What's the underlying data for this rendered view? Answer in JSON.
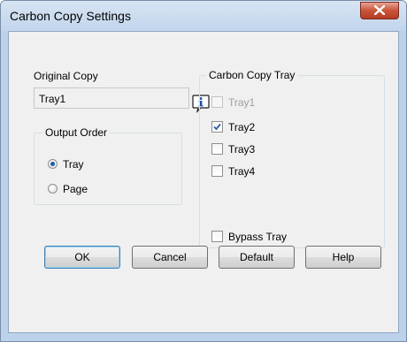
{
  "window": {
    "title": "Carbon Copy Settings",
    "close_icon": "close-x-icon"
  },
  "original_copy": {
    "label": "Original Copy",
    "value": "Tray1"
  },
  "output_order": {
    "title": "Output Order",
    "options": [
      {
        "label": "Tray",
        "checked": true
      },
      {
        "label": "Page",
        "checked": false
      }
    ]
  },
  "carbon_copy_tray": {
    "title": "Carbon Copy Tray",
    "items": [
      {
        "label": "Tray1",
        "checked": false,
        "disabled": true
      },
      {
        "label": "Tray2",
        "checked": true,
        "disabled": false
      },
      {
        "label": "Tray3",
        "checked": false,
        "disabled": false
      },
      {
        "label": "Tray4",
        "checked": false,
        "disabled": false
      }
    ],
    "bypass": {
      "label": "Bypass Tray",
      "checked": false
    }
  },
  "buttons": {
    "ok": "OK",
    "cancel": "Cancel",
    "default": "Default",
    "help": "Help"
  }
}
